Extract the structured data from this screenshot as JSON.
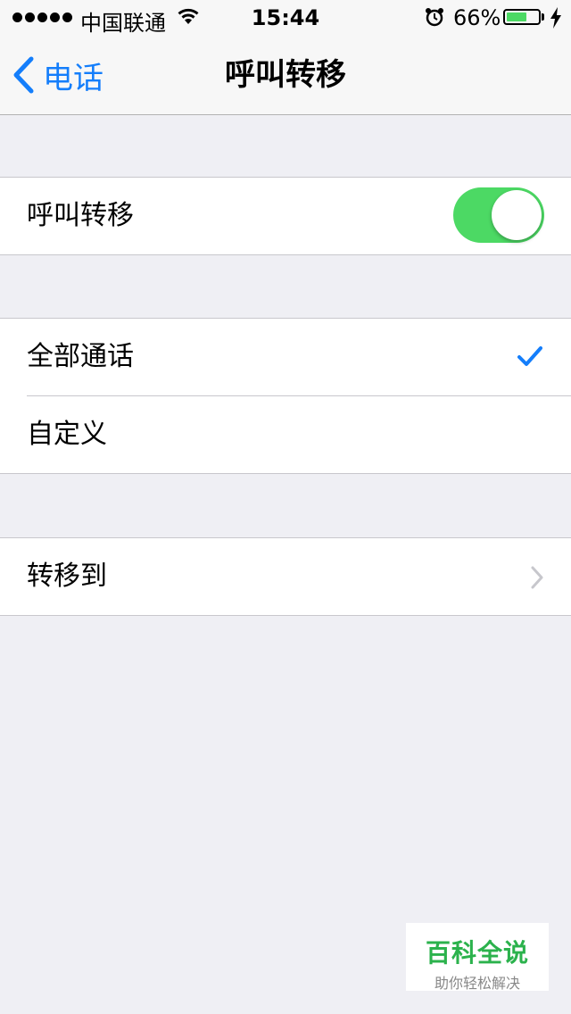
{
  "status_bar": {
    "carrier": "中国联通",
    "time": "15:44",
    "battery_percent_text": "66%",
    "battery_level": 0.66,
    "icons": [
      "signal-dots-icon",
      "wifi-icon",
      "alarm-icon",
      "battery-icon",
      "charging-bolt-icon"
    ]
  },
  "nav": {
    "back_label": "电话",
    "title": "呼叫转移"
  },
  "forward_toggle": {
    "label": "呼叫转移",
    "on": true
  },
  "mode_options": [
    {
      "label": "全部通话",
      "selected": true
    },
    {
      "label": "自定义",
      "selected": false
    }
  ],
  "forward_to": {
    "label": "转移到"
  },
  "watermark": {
    "title": "百科全说",
    "subtitle": "助你轻松解决"
  },
  "colors": {
    "accent": "#147efb",
    "toggle_on": "#4cd964",
    "background": "#efeff4",
    "watermark_green": "#2bb24c"
  }
}
